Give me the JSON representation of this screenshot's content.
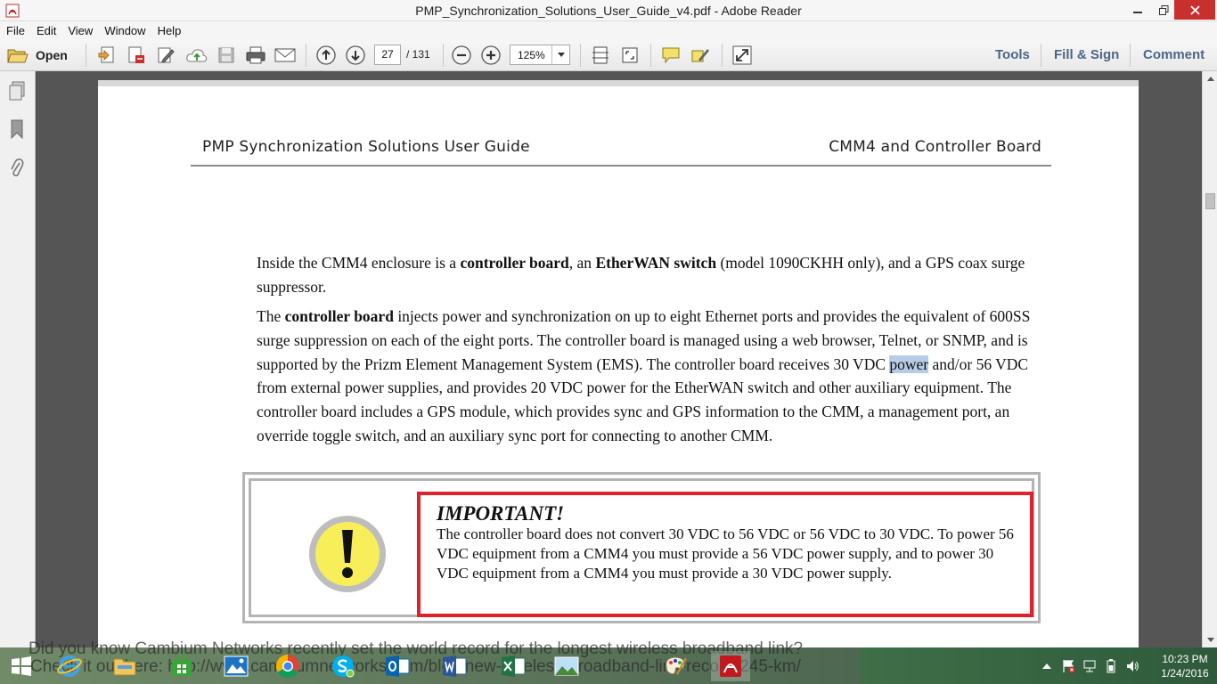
{
  "window": {
    "title": "PMP_Synchronization_Solutions_User_Guide_v4.pdf - Adobe Reader"
  },
  "menu": [
    "File",
    "Edit",
    "View",
    "Window",
    "Help"
  ],
  "toolbar": {
    "open_label": "Open",
    "current_page": "27",
    "total_pages": "/ 131",
    "zoom": "125%",
    "tools_label": "Tools",
    "fill_sign_label": "Fill & Sign",
    "comment_label": "Comment"
  },
  "document": {
    "header_left": "PMP Synchronization Solutions User Guide",
    "header_right": "CMM4 and Controller Board",
    "p1": {
      "t1": "Inside the CMM4 enclosure is a ",
      "b1": "controller board",
      "t2": ", an ",
      "b2": "EtherWAN switch",
      "t3": " (model 1090CKHH only), and a GPS coax surge suppressor."
    },
    "p2": {
      "t1": "The ",
      "b1": "controller board",
      "t2": " injects power and synchronization on up to eight Ethernet ports and provides the equivalent of 600SS surge suppression on each of the eight ports. The controller board is managed using a web browser, Telnet, or SNMP, and is supported by the Prizm Element Management System (EMS). The controller board receives 30 VDC ",
      "hl": "power",
      "t3": " and/or 56 VDC from external power supplies, and provides 20 VDC power for the EtherWAN switch and other auxiliary equipment. The controller board includes a GPS module, which provides sync and GPS information to the CMM, a management port, an override toggle switch, and an auxiliary sync port for connecting to another CMM."
    },
    "important_title": "IMPORTANT!",
    "important_text": "The controller board does not convert 30 VDC to 56 VDC or 56 VDC to 30 VDC. To power 56 VDC equipment from a CMM4 you must provide a 56 VDC power supply, and to power 30 VDC equipment from a CMM4 you must provide a 30 VDC power supply."
  },
  "desktop_ghost": {
    "line1": "Did you know Cambium Networks recently set the world record for the longest wireless broadband link?",
    "line2": "Check it out here: http://www.cambiumnetworks.com/blog/new-wireless-broadband-link-record-245-km/"
  },
  "clock": {
    "time": "10:23 PM",
    "date": "1/24/2016"
  },
  "colors": {
    "important_border": "#e0202a",
    "highlight": "#b7cde6",
    "close_button": "#c7302c",
    "link_text": "#4a6785"
  }
}
